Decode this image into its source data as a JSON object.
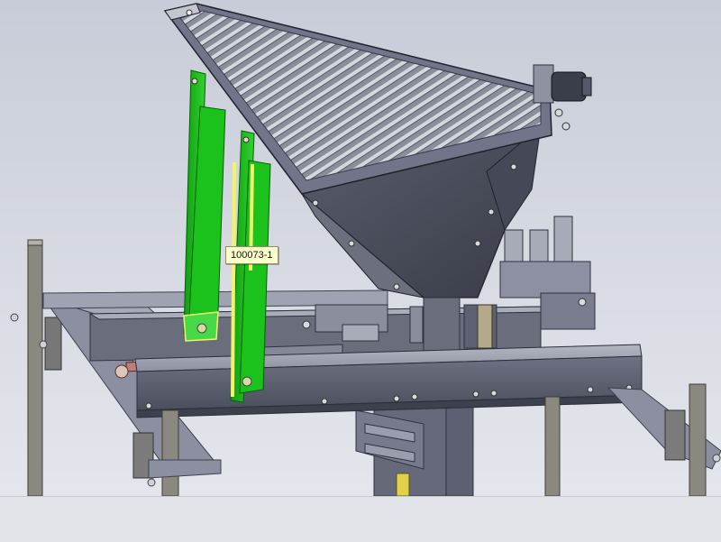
{
  "callout": {
    "label": "100073-1"
  },
  "colors": {
    "selection_green": "#1cc21c",
    "selection_highlight": "#f3f36a",
    "steel": "#6d7080",
    "steel_dark": "#3e4150",
    "steel_light": "#a9acb9",
    "callout_bg": "#ffffcc"
  }
}
